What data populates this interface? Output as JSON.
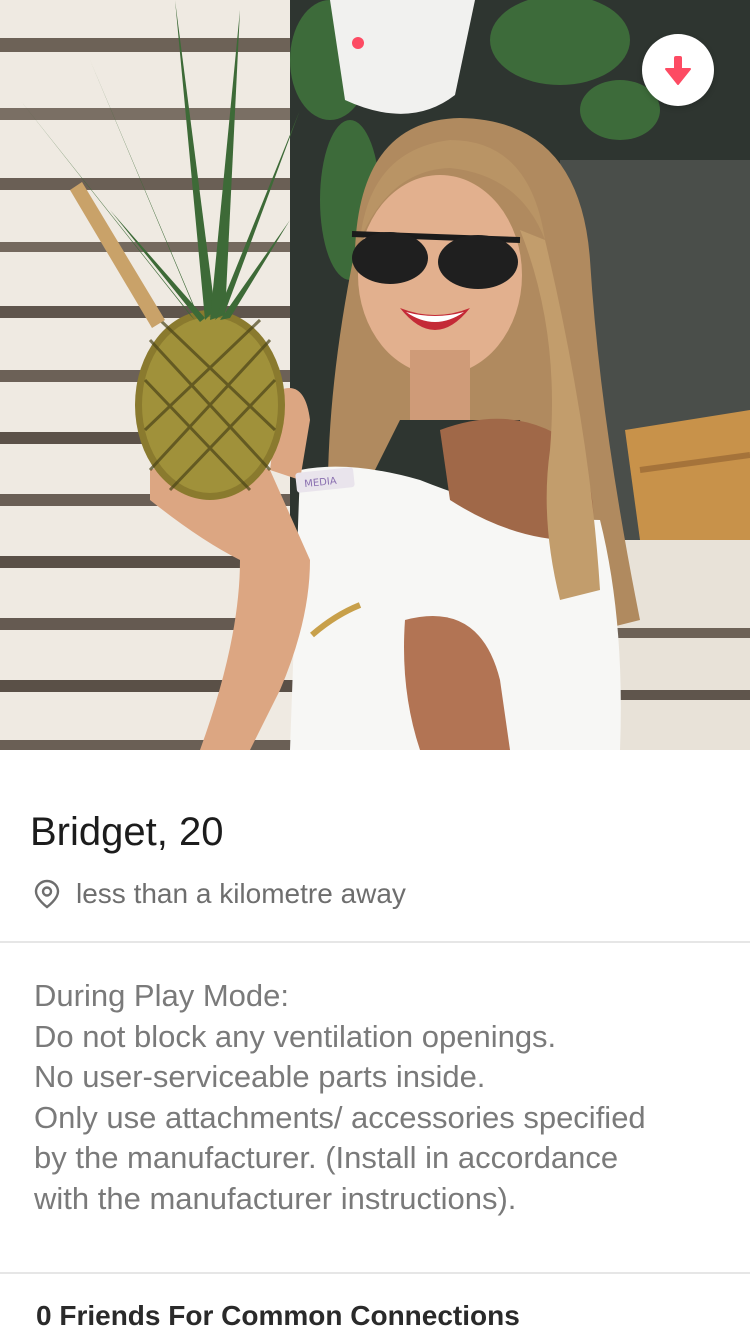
{
  "profile": {
    "name_age": "Bridget, 20",
    "distance": "less than a kilometre away",
    "bio_lines": [
      "During Play Mode:",
      "Do not block any ventilation openings.",
      "No user-serviceable parts inside.",
      "Only use attachments/ accessories specified",
      "by the manufacturer. (Install in accordance",
      "with the manufacturer instructions)."
    ],
    "connections": "0 Friends For Common Connections"
  },
  "photo": {
    "wristband_text": "MEDIA"
  },
  "icons": {
    "collapse": "arrow-down-icon",
    "location": "location-pin-icon"
  },
  "colors": {
    "accent": "#fd4b63",
    "text_primary": "#1c1c1c",
    "text_secondary": "#7a7a7a",
    "divider": "#e6e6e6"
  }
}
